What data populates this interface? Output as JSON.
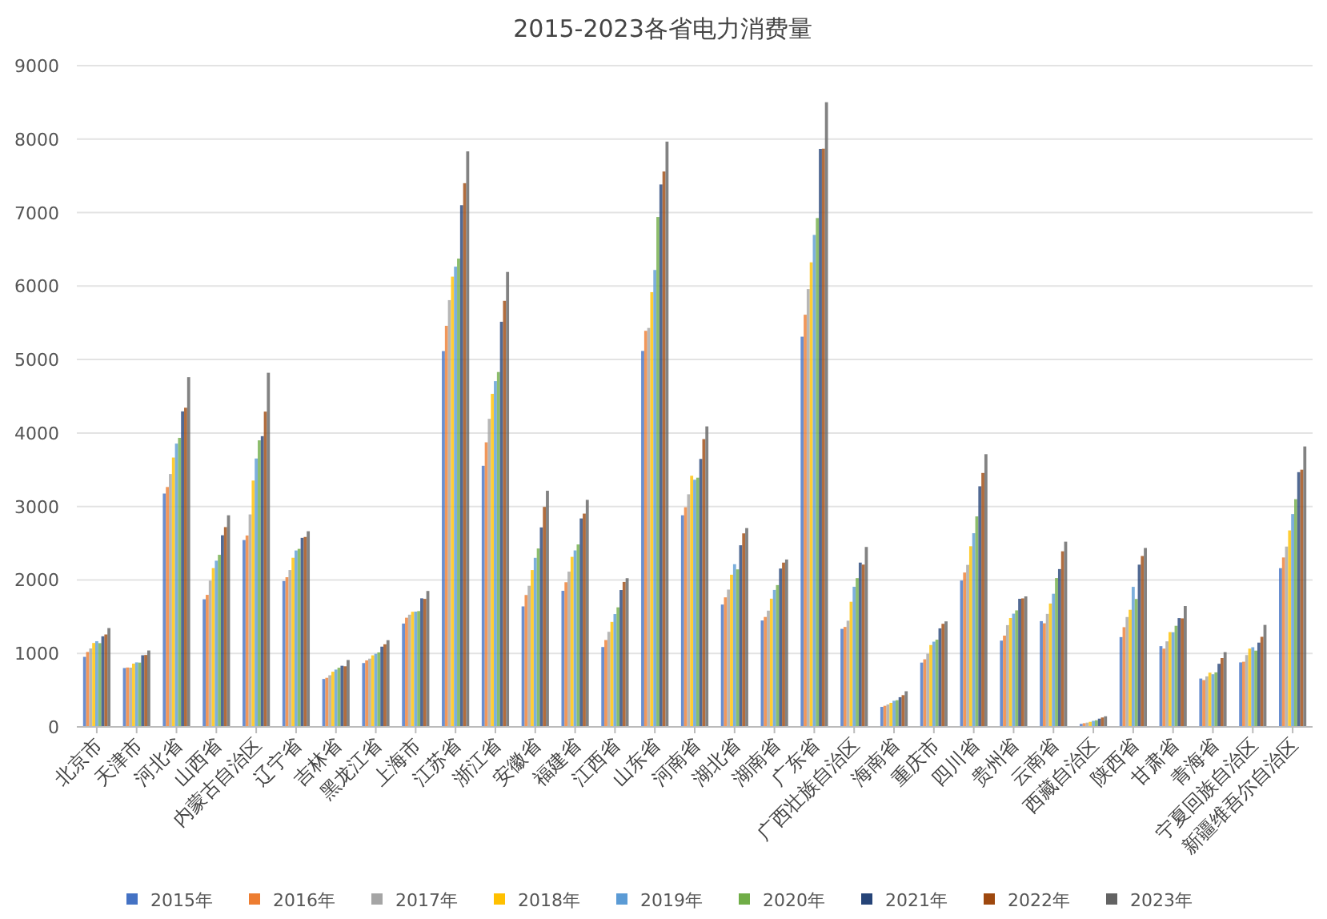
{
  "chart_data": {
    "type": "bar",
    "title": "2015-2023各省电力消费量",
    "categories": [
      "北京市",
      "天津市",
      "河北省",
      "山西省",
      "内蒙古自治区",
      "辽宁省",
      "吉林省",
      "黑龙江省",
      "上海市",
      "江苏省",
      "浙江省",
      "安徽省",
      "福建省",
      "江西省",
      "山东省",
      "河南省",
      "湖北省",
      "湖南省",
      "广东省",
      "广西壮族自治区",
      "海南省",
      "重庆市",
      "四川省",
      "贵州省",
      "云南省",
      "西藏自治区",
      "陕西省",
      "甘肃省",
      "青海省",
      "宁夏回族自治区",
      "新疆维吾尔自治区"
    ],
    "series": [
      {
        "name": "2015年",
        "color": "#4472c4",
        "values": [
          953,
          801,
          3176,
          1737,
          2543,
          1985,
          652,
          869,
          1406,
          5115,
          3554,
          1640,
          1852,
          1087,
          5117,
          2880,
          1665,
          1448,
          5311,
          1334,
          272,
          875,
          1992,
          1174,
          1439,
          41,
          1222,
          1099,
          658,
          878,
          2160
        ]
      },
      {
        "name": "2016年",
        "color": "#ed7d31",
        "values": [
          1020,
          808,
          3265,
          1797,
          2605,
          2037,
          668,
          905,
          1486,
          5459,
          3873,
          1795,
          1969,
          1182,
          5391,
          2989,
          1763,
          1496,
          5610,
          1360,
          287,
          920,
          2101,
          1242,
          1410,
          50,
          1357,
          1065,
          637,
          887,
          2306
        ]
      },
      {
        "name": "2017年",
        "color": "#a5a5a5",
        "values": [
          1067,
          806,
          3442,
          1991,
          2892,
          2135,
          703,
          929,
          1527,
          5808,
          4193,
          1921,
          2113,
          1294,
          5430,
          3166,
          1869,
          1582,
          5959,
          1445,
          305,
          996,
          2205,
          1385,
          1538,
          58,
          1495,
          1164,
          687,
          978,
          2454
        ]
      },
      {
        "name": "2018年",
        "color": "#ffc000",
        "values": [
          1142,
          861,
          3666,
          2161,
          3353,
          2302,
          751,
          974,
          1567,
          6128,
          4533,
          2135,
          2314,
          1429,
          5917,
          3418,
          2071,
          1745,
          6323,
          1703,
          327,
          1114,
          2459,
          1482,
          1679,
          69,
          1594,
          1290,
          738,
          1065,
          2674
        ]
      },
      {
        "name": "2019年",
        "color": "#5b9bd5",
        "values": [
          1166,
          878,
          3856,
          2262,
          3653,
          2401,
          780,
          995,
          1569,
          6264,
          4706,
          2301,
          2402,
          1536,
          6219,
          3364,
          2214,
          1864,
          6696,
          1907,
          355,
          1160,
          2636,
          1541,
          1812,
          82,
          1906,
          1288,
          717,
          1084,
          2897
        ]
      },
      {
        "name": "2020年",
        "color": "#70ad47",
        "values": [
          1140,
          875,
          3934,
          2342,
          3900,
          2423,
          805,
          1014,
          1576,
          6374,
          4830,
          2428,
          2483,
          1627,
          6940,
          3392,
          2144,
          1930,
          6926,
          2025,
          363,
          1187,
          2865,
          1586,
          2026,
          90,
          1741,
          1376,
          742,
          1038,
          3099
        ]
      },
      {
        "name": "2021年",
        "color": "#264478",
        "values": [
          1233,
          975,
          4294,
          2608,
          3957,
          2573,
          832,
          1092,
          1750,
          7101,
          5514,
          2715,
          2837,
          1863,
          7383,
          3647,
          2472,
          2155,
          7867,
          2236,
          404,
          1341,
          3275,
          1743,
          2148,
          112,
          2208,
          1481,
          859,
          1147,
          3467
        ]
      },
      {
        "name": "2022年",
        "color": "#9e480e",
        "values": [
          1258,
          979,
          4344,
          2719,
          4291,
          2585,
          825,
          1124,
          1742,
          7400,
          5799,
          2994,
          2903,
          1973,
          7559,
          3917,
          2634,
          2236,
          7870,
          2209,
          432,
          1403,
          3456,
          1749,
          2390,
          128,
          2326,
          1477,
          937,
          1226,
          3501
        ]
      },
      {
        "name": "2023年",
        "color": "#636363",
        "values": [
          1345,
          1040,
          4760,
          2880,
          4820,
          2663,
          910,
          1180,
          1850,
          7833,
          6192,
          3214,
          3090,
          2024,
          7966,
          4090,
          2706,
          2278,
          8502,
          2449,
          485,
          1436,
          3712,
          1776,
          2521,
          144,
          2435,
          1645,
          1017,
          1388,
          3817
        ]
      }
    ],
    "grid": true,
    "legend": true,
    "ylim": [
      0,
      9000
    ],
    "yticks": [
      0,
      1000,
      2000,
      3000,
      4000,
      5000,
      6000,
      7000,
      8000,
      9000
    ]
  }
}
